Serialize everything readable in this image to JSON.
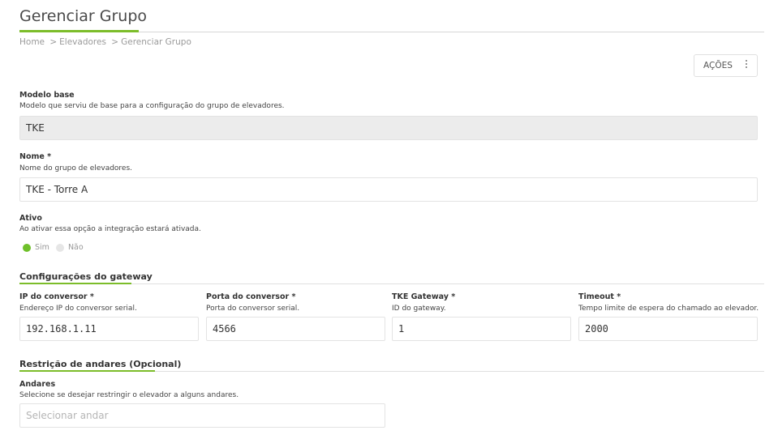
{
  "header": {
    "title": "Gerenciar Grupo",
    "breadcrumb": [
      "Home",
      "Elevadores",
      "Gerenciar Grupo"
    ],
    "breadcrumb_separator": ">",
    "actions_label": "AÇÕES"
  },
  "modelo_base": {
    "label": "Modelo base",
    "help": "Modelo que serviu de base para a configuração do grupo de elevadores.",
    "value": "TKE"
  },
  "nome": {
    "label": "Nome *",
    "help": "Nome do grupo de elevadores.",
    "value": "TKE - Torre A"
  },
  "ativo": {
    "label": "Ativo",
    "help": "Ao ativar essa opção a integração estará ativada.",
    "options": [
      {
        "label": "Sim",
        "selected": true
      },
      {
        "label": "Não",
        "selected": false
      }
    ]
  },
  "gateway": {
    "section_title": "Configurações do gateway",
    "fields": [
      {
        "label": "IP do conversor *",
        "help": "Endereço IP do conversor serial.",
        "value": "192.168.1.11"
      },
      {
        "label": "Porta do conversor *",
        "help": "Porta do conversor serial.",
        "value": "4566"
      },
      {
        "label": "TKE Gateway *",
        "help": "ID do gateway.",
        "value": "1"
      },
      {
        "label": "Timeout *",
        "help": "Tempo limite de espera do chamado ao elevador.",
        "value": "2000"
      }
    ]
  },
  "andares": {
    "section_title": "Restrição de andares (Opcional)",
    "label": "Andares",
    "help": "Selecione se desejar restringir o elevador a alguns andares.",
    "placeholder": "Selecionar andar"
  },
  "colors": {
    "accent": "#7cbd2a",
    "radio_on": "#6fc02a",
    "disabled_bg": "#ececec"
  },
  "icons": {
    "actions": "more-vertical-icon"
  }
}
